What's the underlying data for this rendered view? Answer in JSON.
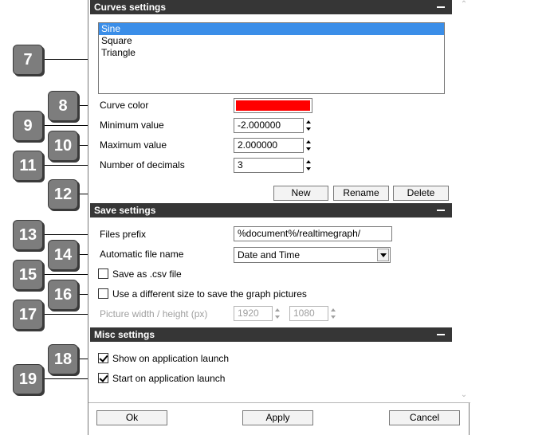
{
  "sections": {
    "curves": "Curves settings",
    "save": "Save settings",
    "misc": "Misc settings"
  },
  "curves_list": [
    "Sine",
    "Square",
    "Triangle"
  ],
  "curve_color_label": "Curve color",
  "curve_color": "#ff0000",
  "minimum_label": "Minimum value",
  "minimum_value": "-2.000000",
  "maximum_label": "Maximum value",
  "maximum_value": "2.000000",
  "decimals_label": "Number of decimals",
  "decimals_value": "3",
  "buttons": {
    "new": "New",
    "rename": "Rename",
    "delete": "Delete",
    "ok": "Ok",
    "apply": "Apply",
    "cancel": "Cancel"
  },
  "files_prefix_label": "Files prefix",
  "files_prefix_value": "%document%/realtimegraph/",
  "auto_file_name_label": "Automatic file name",
  "auto_file_name_value": "Date and Time",
  "save_csv_label": "Save as .csv file",
  "diff_size_label": "Use a different size to save the graph pictures",
  "picture_size_label": "Picture width / height (px)",
  "picture_width": "1920",
  "picture_height": "1080",
  "show_on_launch_label": "Show on application launch",
  "start_on_launch_label": "Start on application launch",
  "callouts": [
    "7",
    "8",
    "9",
    "10",
    "11",
    "12",
    "13",
    "14",
    "15",
    "16",
    "17",
    "18",
    "19"
  ]
}
